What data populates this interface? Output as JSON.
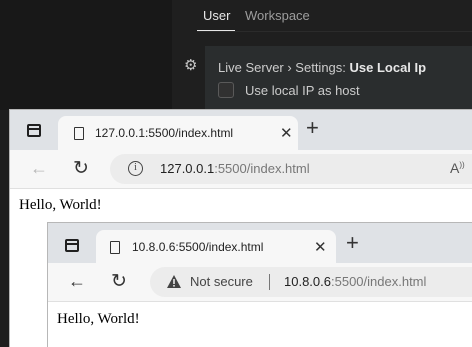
{
  "vscode": {
    "tabs": [
      "User",
      "Workspace"
    ],
    "setting": {
      "title_prefix": "Live Server › Settings: ",
      "title_name": "Use Local Ip",
      "checkbox_label": "Use local IP as host",
      "checked": false
    }
  },
  "browser1": {
    "tab_title": "127.0.0.1:5500/index.html",
    "url_host": "127.0.0.1",
    "url_rest": ":5500/index.html",
    "page_text": "Hello, World!"
  },
  "browser2": {
    "tab_title": "10.8.0.6:5500/index.html",
    "security_text": "Not secure",
    "url_host": "10.8.0.6",
    "url_rest": ":5500/index.html",
    "page_text": "Hello, World!"
  },
  "colors": {
    "vscode_bg": "#1e1e1e",
    "browser_tabstrip": "#dfe2e6",
    "browser_toolbar": "#f7f7f7"
  },
  "icons": [
    "gear-icon",
    "tab-actions-icon",
    "page-icon",
    "close-icon",
    "new-tab-icon",
    "back-icon",
    "reload-icon",
    "info-icon",
    "read-aloud-icon",
    "warning-icon"
  ]
}
